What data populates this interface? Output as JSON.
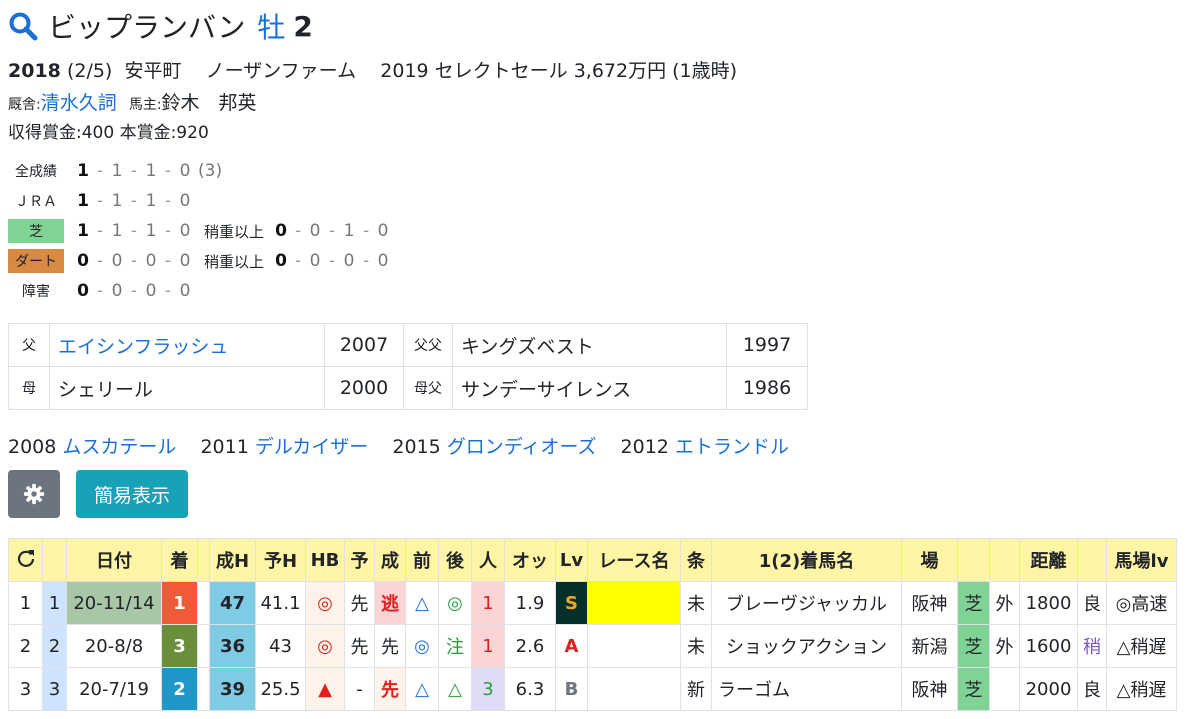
{
  "horse": {
    "name": "ビップランバン",
    "sex": "牡",
    "age": "2"
  },
  "info": {
    "year": "2018",
    "birthdate": "(2/5)",
    "area": "安平町",
    "breeder": "ノーザンファーム",
    "sale": "2019 セレクトセール 3,672万円 (1歳時)"
  },
  "stable": {
    "trainer_label": "厩舎:",
    "trainer": "清水久詞",
    "owner_label": "馬主:",
    "owner": "鈴木　邦英"
  },
  "prize": "収得賞金:400  本賞金:920",
  "records": [
    {
      "label": "全成績",
      "vals": [
        "1",
        "1",
        "1",
        "0"
      ],
      "extra": "(3)"
    },
    {
      "label": "ＪＲＡ",
      "vals": [
        "1",
        "1",
        "1",
        "0"
      ]
    },
    {
      "label": "芝",
      "vals": [
        "1",
        "1",
        "1",
        "0"
      ],
      "sub": "稍重以上",
      "subvals": [
        "0",
        "0",
        "1",
        "0"
      ]
    },
    {
      "label": "ダート",
      "vals": [
        "0",
        "0",
        "0",
        "0"
      ],
      "sub": "稍重以上",
      "subvals": [
        "0",
        "0",
        "0",
        "0"
      ]
    },
    {
      "label": "障害",
      "vals": [
        "0",
        "0",
        "0",
        "0"
      ]
    }
  ],
  "pedigree": {
    "sire_label": "父",
    "sire": "エイシンフラッシュ",
    "sire_year": "2007",
    "ss_label": "父父",
    "ss": "キングズベスト",
    "ss_year": "1997",
    "dam_label": "母",
    "dam": "シェリール",
    "dam_year": "2000",
    "ds_label": "母父",
    "ds": "サンデーサイレンス",
    "ds_year": "1986"
  },
  "siblings": [
    {
      "year": "2008",
      "name": "ムスカテール"
    },
    {
      "year": "2011",
      "name": "デルカイザー"
    },
    {
      "year": "2015",
      "name": "グロンディオーズ"
    },
    {
      "year": "2012",
      "name": "エトランドル"
    }
  ],
  "buttons": {
    "simple": "簡易表示"
  },
  "table": {
    "headers": [
      "",
      "",
      "日付",
      "着",
      "",
      "成H",
      "予H",
      "HB",
      "予",
      "成",
      "前",
      "後",
      "人",
      "オッ",
      "Lv",
      "レース名",
      "条",
      "1(2)着馬名",
      "場",
      "",
      "",
      "距離",
      "",
      "馬場lv"
    ],
    "rows": [
      [
        "1",
        "1",
        "20-11/14",
        "1",
        "",
        "47",
        "41.1",
        "◎",
        "先",
        "逃",
        "△",
        "◎",
        "1",
        "1.9",
        "S",
        "",
        "未",
        "ブレーヴジャッカル",
        "阪神",
        "芝",
        "外",
        "1800",
        "良",
        "◎高速"
      ],
      [
        "2",
        "2",
        "20-8/8",
        "3",
        "",
        "36",
        "43",
        "◎",
        "先",
        "先",
        "◎",
        "注",
        "1",
        "2.6",
        "A",
        "",
        "未",
        "ショックアクション",
        "新潟",
        "芝",
        "外",
        "1600",
        "稍",
        "△稍遅"
      ],
      [
        "3",
        "3",
        "20-7/19",
        "2",
        "",
        "39",
        "25.5",
        "▲",
        "-",
        "先",
        "△",
        "△",
        "3",
        "6.3",
        "B",
        "",
        "新",
        "ラーゴム",
        "阪神",
        "芝",
        "",
        "2000",
        "良",
        "△稍遅"
      ]
    ]
  },
  "colors": {
    "accent": "#1a6fd6",
    "gear_btn": "#6c757d",
    "simple_btn": "#17a2b8",
    "header_bg": "#fff5a5"
  }
}
